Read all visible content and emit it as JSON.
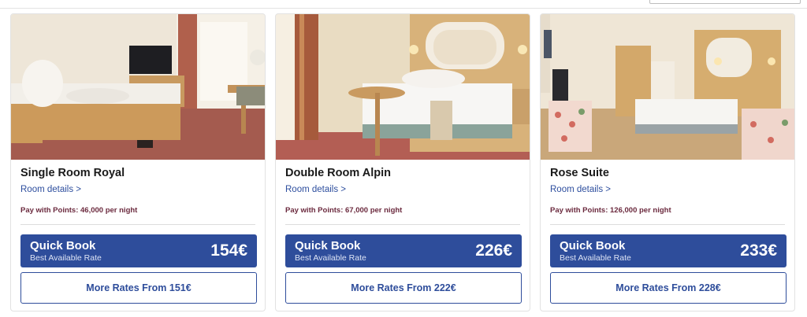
{
  "rooms": [
    {
      "title": "Single Room Royal",
      "details_link": "Room details >",
      "points_text": "Pay with Points: 46,000 per night",
      "quick_book": {
        "label": "Quick Book",
        "sublabel": "Best Available Rate",
        "price": "154€"
      },
      "more_rates": "More Rates From 151€"
    },
    {
      "title": "Double Room Alpin",
      "details_link": "Room details >",
      "points_text": "Pay with Points: 67,000 per night",
      "quick_book": {
        "label": "Quick Book",
        "sublabel": "Best Available Rate",
        "price": "226€"
      },
      "more_rates": "More Rates From 222€"
    },
    {
      "title": "Rose Suite",
      "details_link": "Room details >",
      "points_text": "Pay with Points: 126,000 per night",
      "quick_book": {
        "label": "Quick Book",
        "sublabel": "Best Available Rate",
        "price": "233€"
      },
      "more_rates": "More Rates From 228€"
    }
  ],
  "colors": {
    "primary": "#2e4d9b",
    "points_text": "#6b2a3e",
    "link": "#2d4e9e"
  }
}
